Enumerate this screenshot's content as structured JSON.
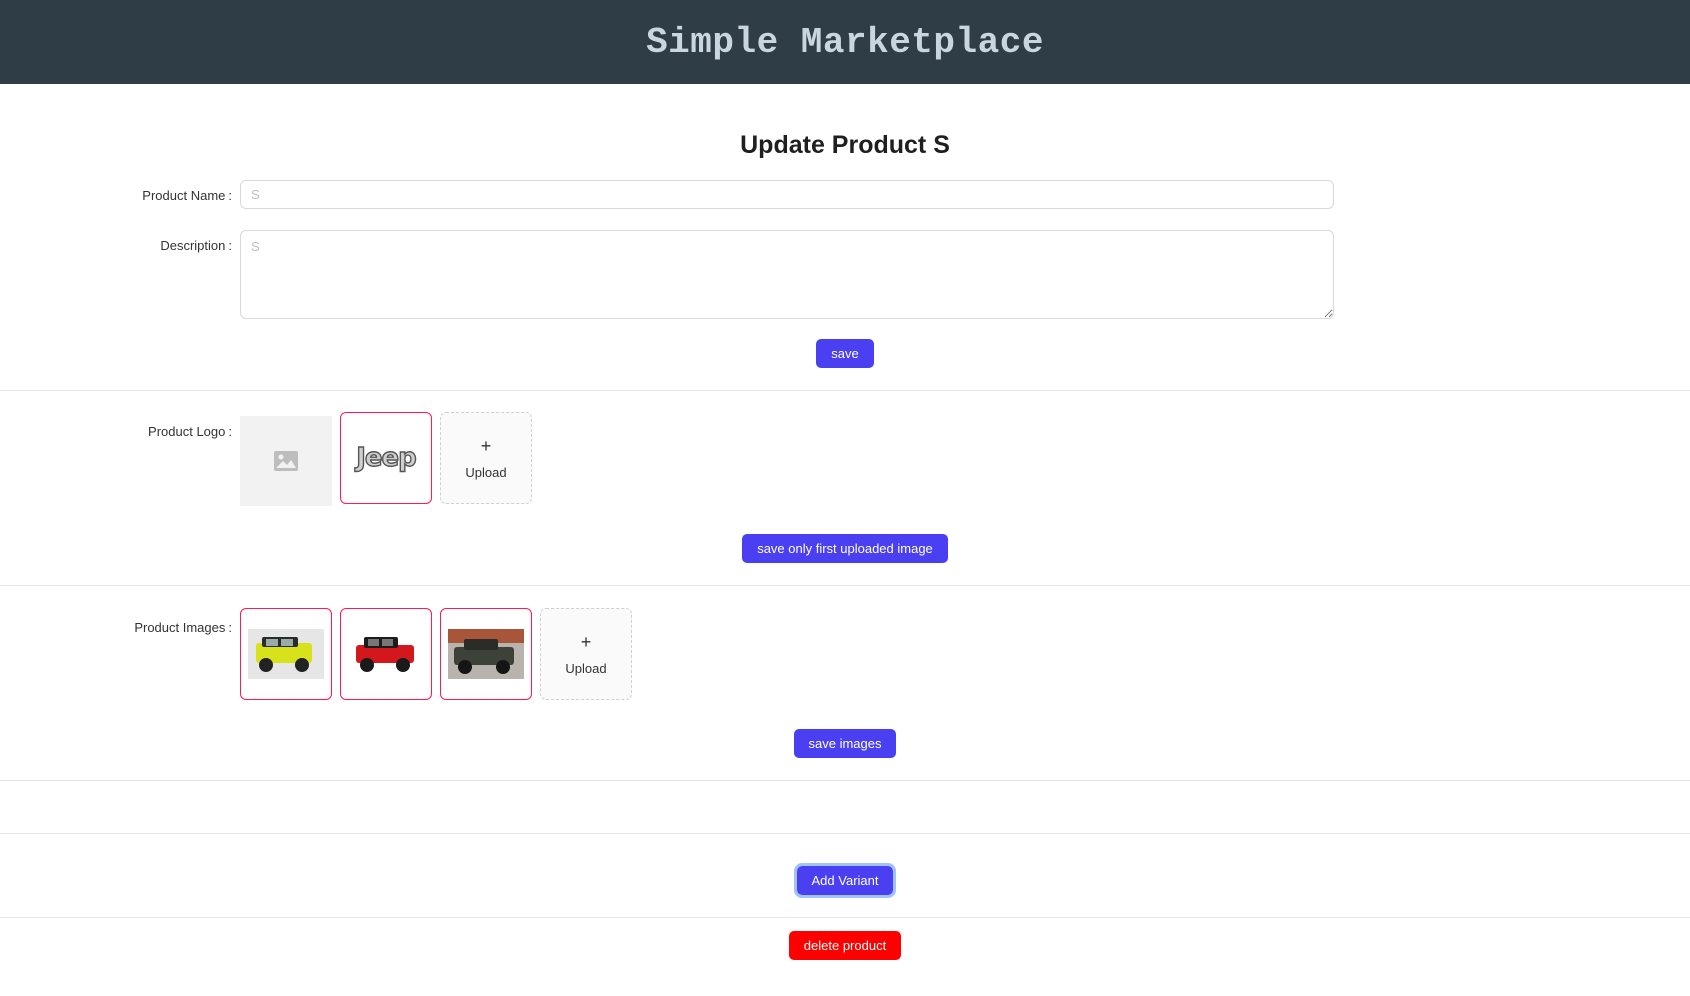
{
  "header": {
    "title": "Simple Marketplace"
  },
  "page": {
    "title": "Update Product S"
  },
  "form": {
    "name_label": "Product Name",
    "name_placeholder": "S",
    "description_label": "Description",
    "description_placeholder": "S",
    "save_label": "save"
  },
  "logo": {
    "label": "Product Logo",
    "logo_text": "Jeep",
    "upload_label": "Upload",
    "save_label": "save only first uploaded image"
  },
  "images": {
    "label": "Product Images",
    "cars": [
      {
        "name": "yellow-jeep",
        "body_color": "#d8e21a",
        "bg": "#e6e6e6"
      },
      {
        "name": "red-jeep",
        "body_color": "#d4161d",
        "bg": "#ffffff"
      },
      {
        "name": "dark-jeep",
        "body_color": "#3d4238",
        "bg": "#a8553a"
      }
    ],
    "upload_label": "Upload",
    "save_label": "save images"
  },
  "actions": {
    "add_variant_label": "Add Variant",
    "delete_label": "delete product"
  },
  "colors": {
    "header_bg": "#2f3d47",
    "primary": "#4b3ff2",
    "danger": "#ff0000",
    "selected_border": "#ff1a52"
  }
}
